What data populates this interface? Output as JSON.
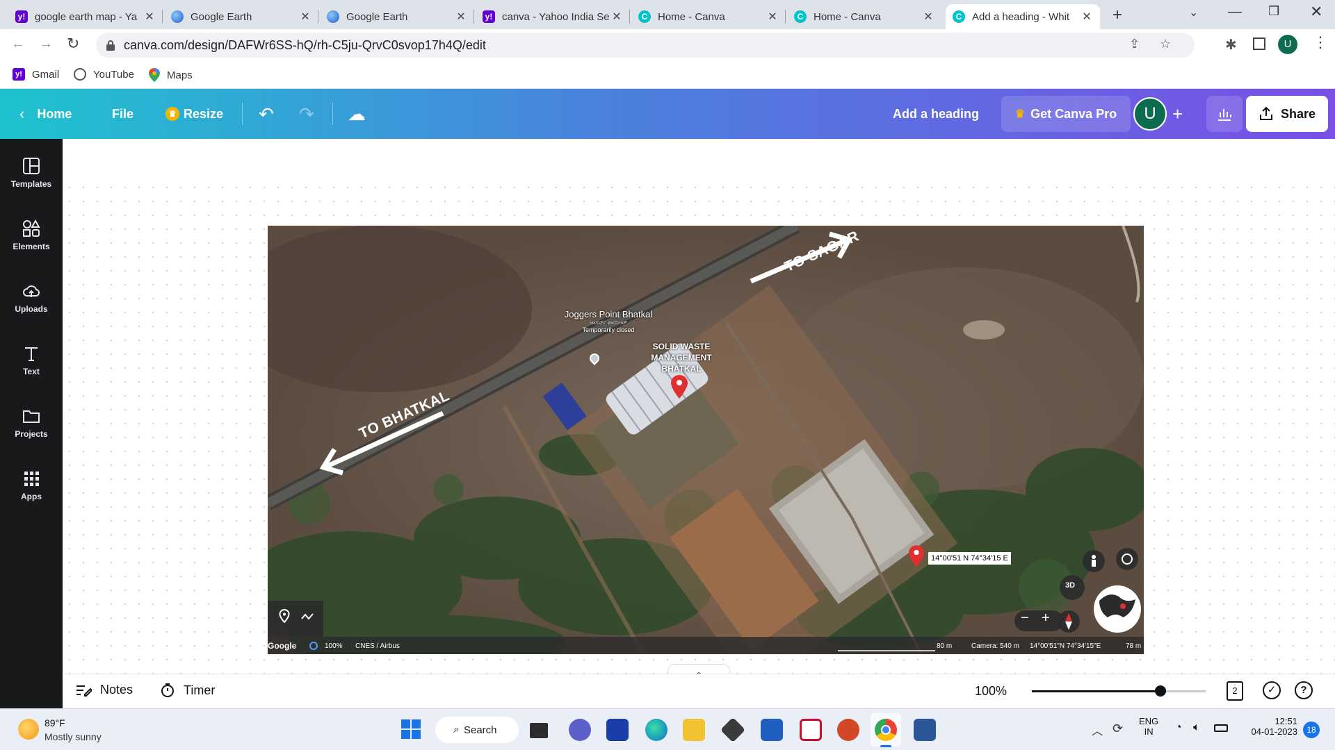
{
  "browser": {
    "tabs": [
      {
        "title": "google earth map - Ya",
        "active": false
      },
      {
        "title": "Google Earth",
        "active": false
      },
      {
        "title": "Google Earth",
        "active": false
      },
      {
        "title": "canva - Yahoo India Se",
        "active": false
      },
      {
        "title": "Home - Canva",
        "active": false
      },
      {
        "title": "Home - Canva",
        "active": false
      },
      {
        "title": "Add a heading - Whit",
        "active": true
      }
    ],
    "url": "canva.com/design/DAFWr6SS-hQ/rh-C5ju-QrvC0svop17h4Q/edit",
    "profile_initial": "U",
    "bookmarks": [
      {
        "label": "Gmail",
        "icon": "yahoo-icon"
      },
      {
        "label": "YouTube",
        "icon": "globe-icon"
      },
      {
        "label": "Maps",
        "icon": "maps-pin-icon"
      }
    ]
  },
  "canva": {
    "header": {
      "home": "Home",
      "file": "File",
      "resize": "Resize",
      "design_title": "Add a heading",
      "get_pro": "Get Canva Pro",
      "avatar_initial": "U",
      "share": "Share"
    },
    "sidebar": [
      {
        "label": "Templates",
        "icon": "templates-icon"
      },
      {
        "label": "Elements",
        "icon": "elements-icon"
      },
      {
        "label": "Uploads",
        "icon": "uploads-icon"
      },
      {
        "label": "Text",
        "icon": "text-icon"
      },
      {
        "label": "Projects",
        "icon": "folder-icon"
      },
      {
        "label": "Apps",
        "icon": "apps-grid-icon"
      }
    ],
    "map": {
      "label_sagar": "TO SAGAR",
      "label_bhatkal": "TO BHATKAL",
      "poi_title": "Joggers Point Bhatkal",
      "poi_local": "ಜಾಗರ್ಸ್ ಪಾಯಿಂಟ್",
      "poi_status": "Temporarily closed",
      "site_line1": "SOLID WASTE",
      "site_line2": "MANAGEMENT",
      "site_line3": "BHATKAL",
      "coords_tag": "14°00'51 N 74°34'15 E",
      "btn_3d": "3D",
      "footer_google": "Google",
      "footer_zoom": "100%",
      "footer_imagery": "CNES / Airbus",
      "footer_scale": "80 m",
      "footer_camera": "Camera: 540 m",
      "footer_coords": "14°00'51\"N 74°34'15\"E",
      "footer_elev": "78 m"
    },
    "bottom": {
      "notes": "Notes",
      "timer": "Timer",
      "zoom": "100%",
      "zoom_fraction": 0.74,
      "page_count": "2"
    }
  },
  "taskbar": {
    "weather_temp": "89°F",
    "weather_desc": "Mostly sunny",
    "search": "Search",
    "lang1": "ENG",
    "lang2": "IN",
    "time": "12:51",
    "date": "04-01-2023",
    "notif_count": "18"
  },
  "colors": {
    "canva_teal": "#1ec3cf",
    "canva_purple": "#7a4fe6",
    "sidebar_bg": "#18191b",
    "pin_red": "#e02f2f"
  }
}
